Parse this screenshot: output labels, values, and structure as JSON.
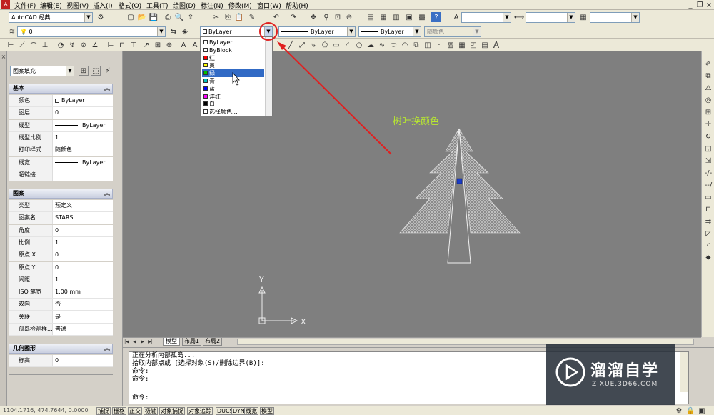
{
  "menu": [
    "文件(F)",
    "编辑(E)",
    "视图(V)",
    "插入(I)",
    "格式(O)",
    "工具(T)",
    "绘图(D)",
    "标注(N)",
    "修改(M)",
    "窗口(W)",
    "帮助(H)"
  ],
  "toolbar": {
    "workspace": "AutoCAD 经典",
    "layer": "0",
    "color": "ByLayer",
    "linetype": "ByLayer",
    "lineweight": "ByLayer",
    "plotstyle": "随颜色"
  },
  "dropdown": {
    "items": [
      "ByLayer",
      "ByBlock",
      "红",
      "黄",
      "绿",
      "青",
      "蓝",
      "洋红",
      "白",
      "选择颜色..."
    ],
    "swatches": [
      "#ffffff",
      "#ffffff",
      "#ff0000",
      "#ffff00",
      "#00c000",
      "#00c0c0",
      "#0000ff",
      "#ff00ff",
      "#000000",
      "#ffffff"
    ],
    "selected": "绿"
  },
  "panel": {
    "object_type": "图案填充",
    "sections": {
      "basic": "基本",
      "pattern": "图案",
      "geometry": "几何图形"
    },
    "basic_rows": [
      {
        "k": "颜色",
        "v": "ByLayer"
      },
      {
        "k": "图层",
        "v": "0"
      },
      {
        "k": "线型",
        "v": "ByLayer"
      },
      {
        "k": "线型比例",
        "v": "1"
      },
      {
        "k": "打印样式",
        "v": "随颜色"
      },
      {
        "k": "线宽",
        "v": "ByLayer"
      },
      {
        "k": "超链接",
        "v": ""
      }
    ],
    "pattern_rows": [
      {
        "k": "类型",
        "v": "预定义"
      },
      {
        "k": "图案名",
        "v": "STARS"
      },
      {
        "k": "角度",
        "v": "0"
      },
      {
        "k": "比例",
        "v": "1"
      },
      {
        "k": "原点 X",
        "v": "0"
      },
      {
        "k": "原点 Y",
        "v": "0"
      },
      {
        "k": "间距",
        "v": "1"
      },
      {
        "k": "ISO 笔宽",
        "v": "1.00 mm"
      },
      {
        "k": "双向",
        "v": "否"
      },
      {
        "k": "关联",
        "v": "是"
      },
      {
        "k": "孤岛检测样...",
        "v": "普通"
      }
    ],
    "geometry_rows": [
      {
        "k": "标高",
        "v": "0"
      }
    ]
  },
  "canvas": {
    "annotation": "树叶换颜色",
    "ucs_x": "X",
    "ucs_y": "Y",
    "accent": "#e02020",
    "annotation_color": "#b8e830"
  },
  "tabs": [
    "模型",
    "布局1",
    "布局2"
  ],
  "command_lines": [
    "正在分析内部孤岛...",
    "拾取内部点或 [选择对象(S)/删除边界(B)]:",
    "命令:",
    "命令:"
  ],
  "command_prompt": "命令:",
  "status": {
    "coords": "1104.1716, 474.7644, 0.0000",
    "buttons": [
      "捕捉",
      "栅格",
      "正交",
      "极轴",
      "对象捕捉",
      "对象追踪",
      "DUCS",
      "DYN",
      "线宽",
      "模型"
    ]
  },
  "watermark": {
    "brand": "溜溜自学",
    "url": "ZIXUE.3D66.COM"
  }
}
